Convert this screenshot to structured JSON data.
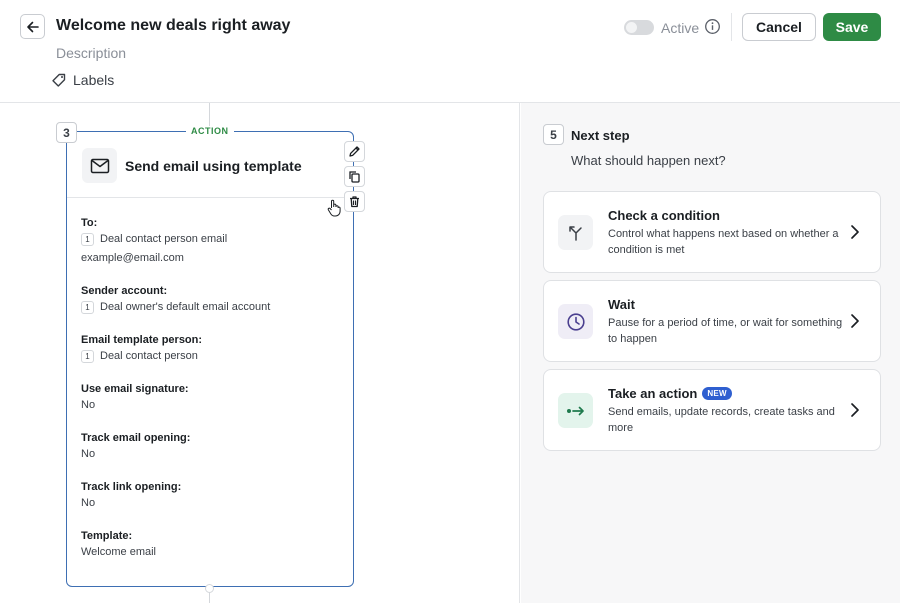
{
  "header": {
    "title": "Welcome new deals right away",
    "description_placeholder": "Description",
    "labels_label": "Labels",
    "active_label": "Active",
    "active_on": false,
    "cancel_label": "Cancel",
    "save_label": "Save",
    "save_color": "#2e8b45"
  },
  "step": {
    "number": "3",
    "badge": "ACTION",
    "title": "Send email using template",
    "icon": "envelope-icon",
    "fields": [
      {
        "label": "To:",
        "lines": [
          {
            "chip": "1",
            "text": "Deal contact person email"
          },
          {
            "chip": null,
            "text": "example@email.com"
          }
        ]
      },
      {
        "label": "Sender account:",
        "lines": [
          {
            "chip": "1",
            "text": "Deal owner's default email account"
          }
        ]
      },
      {
        "label": "Email template person:",
        "lines": [
          {
            "chip": "1",
            "text": "Deal contact person"
          }
        ]
      },
      {
        "label": "Use email signature:",
        "lines": [
          {
            "chip": null,
            "text": "No"
          }
        ]
      },
      {
        "label": "Track email opening:",
        "lines": [
          {
            "chip": null,
            "text": "No"
          }
        ]
      },
      {
        "label": "Track link opening:",
        "lines": [
          {
            "chip": null,
            "text": "No"
          }
        ]
      },
      {
        "label": "Template:",
        "lines": [
          {
            "chip": null,
            "text": "Welcome email"
          }
        ]
      }
    ]
  },
  "next_step": {
    "number": "5",
    "title": "Next step",
    "subtitle": "What should happen next?",
    "options": [
      {
        "title": "Check a condition",
        "badge": "",
        "desc": "Control what happens next based on whether a condition is met",
        "icon": "branch-icon",
        "icon_bg": "#f2f3f5",
        "icon_color": "#3a3f46"
      },
      {
        "title": "Wait",
        "badge": "",
        "desc": "Pause for a period of time, or wait for something to happen",
        "icon": "clock-icon",
        "icon_bg": "#efedf6",
        "icon_color": "#4a3f8f"
      },
      {
        "title": "Take an action",
        "badge": "NEW",
        "desc": "Send emails, update records, create tasks and more",
        "icon": "action-arrow-icon",
        "icon_bg": "#e3f4ec",
        "icon_color": "#1f7a4d"
      }
    ]
  }
}
